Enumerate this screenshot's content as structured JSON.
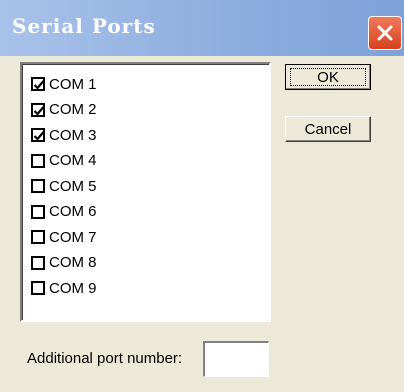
{
  "window": {
    "title": "Serial Ports",
    "close_icon": "close-icon",
    "titlebar_color": "#95b3e2",
    "close_color": "#d6421e"
  },
  "ports": [
    {
      "label": "COM 1",
      "checked": true
    },
    {
      "label": "COM 2",
      "checked": true
    },
    {
      "label": "COM 3",
      "checked": true
    },
    {
      "label": "COM 4",
      "checked": false
    },
    {
      "label": "COM 5",
      "checked": false
    },
    {
      "label": "COM 6",
      "checked": false
    },
    {
      "label": "COM 7",
      "checked": false
    },
    {
      "label": "COM 8",
      "checked": false
    },
    {
      "label": "COM 9",
      "checked": false
    }
  ],
  "buttons": {
    "ok_label": "OK",
    "cancel_label": "Cancel"
  },
  "additional": {
    "label": "Additional port number:",
    "value": ""
  }
}
